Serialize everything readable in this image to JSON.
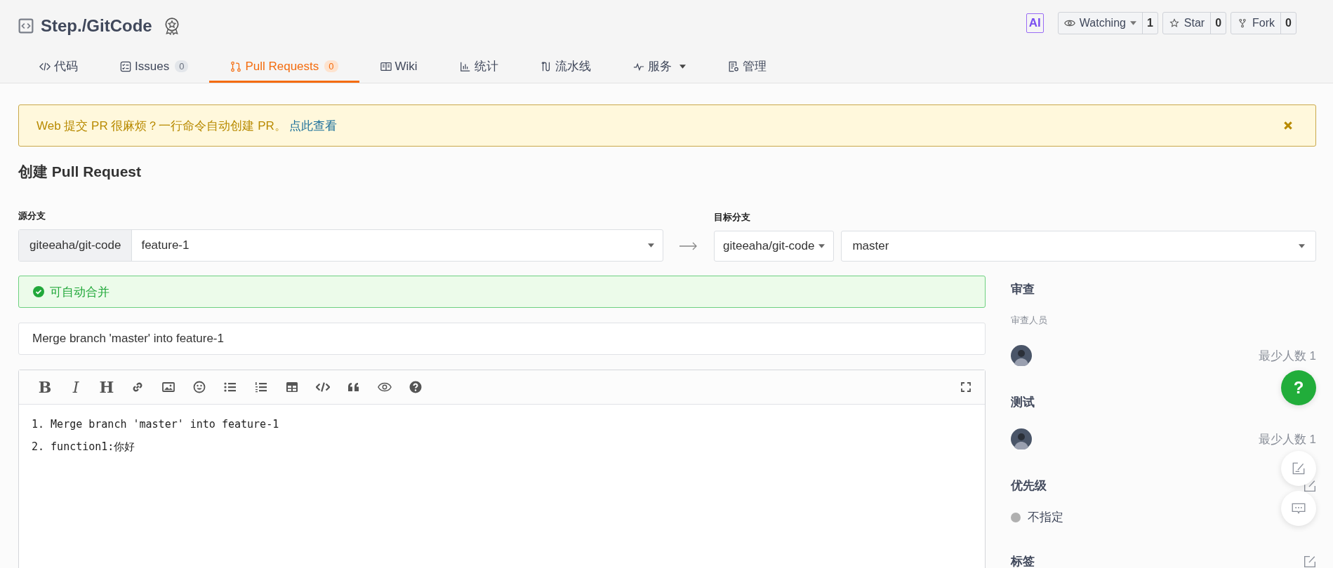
{
  "repo": {
    "title": "Step./GitCode"
  },
  "ai_badge": "AI",
  "actions": [
    {
      "kind": "watch",
      "label": "Watching",
      "count": "1",
      "dropdown": true
    },
    {
      "kind": "star",
      "label": "Star",
      "count": "0",
      "dropdown": false
    },
    {
      "kind": "fork",
      "label": "Fork",
      "count": "0",
      "dropdown": false
    }
  ],
  "tabs": [
    {
      "kind": "code",
      "label": "代码",
      "selected": false
    },
    {
      "kind": "issues",
      "label": "Issues",
      "count": "0",
      "selected": false
    },
    {
      "kind": "pulls",
      "label": "Pull Requests",
      "count": "0",
      "selected": true
    },
    {
      "kind": "wiki",
      "label": "Wiki",
      "selected": false
    },
    {
      "kind": "stats",
      "label": "统计",
      "selected": false
    },
    {
      "kind": "pipeline",
      "label": "流水线",
      "selected": false
    },
    {
      "kind": "service",
      "label": "服务",
      "dropdown": true,
      "selected": false
    },
    {
      "kind": "manage",
      "label": "管理",
      "selected": false
    }
  ],
  "notice": {
    "text": "Web 提交 PR 很麻烦？一行命令自动创建 PR。",
    "link": "点此查看"
  },
  "heading": "创建 Pull Request",
  "source": {
    "label": "源分支",
    "repo": "giteeaha/git-code",
    "branch": "feature-1"
  },
  "target": {
    "label": "目标分支",
    "repo": "giteeaha/git-code",
    "branch": "master"
  },
  "merge_status": "可自动合并",
  "pr_title": {
    "value": "Merge branch 'master' into feature-1"
  },
  "toolbar": [
    {
      "kind": "bold",
      "text": "B"
    },
    {
      "kind": "italic",
      "text": "I"
    },
    {
      "kind": "heading",
      "text": "H"
    },
    {
      "kind": "link"
    },
    {
      "kind": "image"
    },
    {
      "kind": "emoji"
    },
    {
      "kind": "ul"
    },
    {
      "kind": "ol"
    },
    {
      "kind": "table"
    },
    {
      "kind": "code"
    },
    {
      "kind": "quote"
    },
    {
      "kind": "preview"
    },
    {
      "kind": "help"
    }
  ],
  "editor": {
    "lines": [
      "1. Merge branch 'master' into feature-1",
      "2. function1:你好"
    ]
  },
  "sidebar": [
    {
      "kind": "people",
      "title": "审查",
      "subtitle": "审查人员",
      "min": "最少人数 1"
    },
    {
      "kind": "people",
      "title": "测试",
      "min": "最少人数 1"
    },
    {
      "kind": "priority",
      "title": "优先级",
      "value": "不指定",
      "editable": true
    },
    {
      "kind": "plain",
      "title": "标签",
      "editable": true
    }
  ],
  "help_button": "?"
}
